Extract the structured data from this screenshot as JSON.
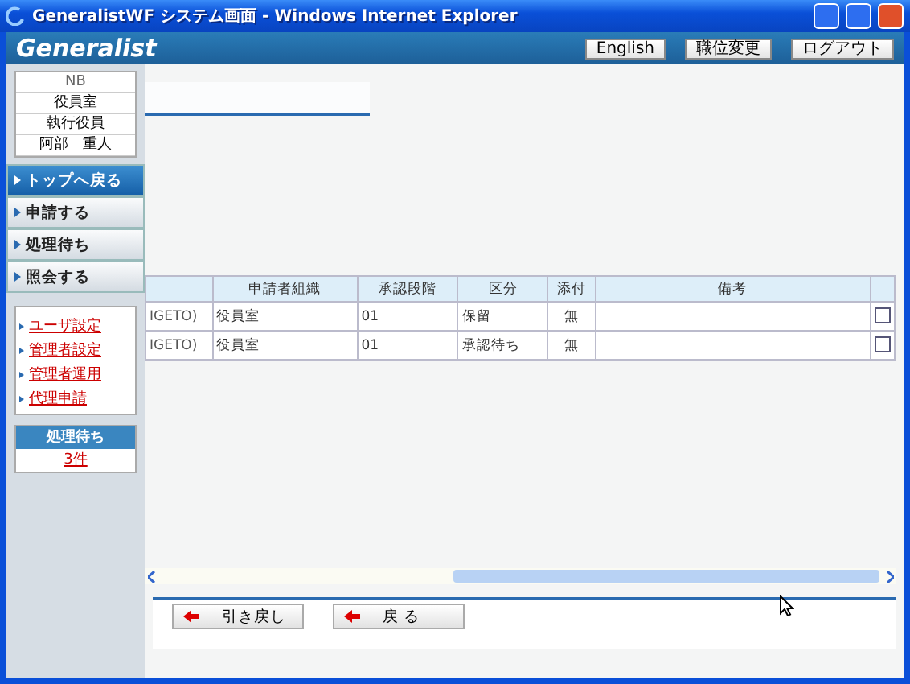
{
  "window": {
    "title": "GeneralistWF システム画面 - Windows Internet Explorer"
  },
  "header": {
    "logo": "Generalist",
    "buttons": [
      "English",
      "職位変更",
      "ログアウト"
    ]
  },
  "user_info": [
    "NB",
    "役員室",
    "執行役員",
    "阿部　重人"
  ],
  "menu": [
    {
      "label": "トップへ戻る",
      "selected": true
    },
    {
      "label": "申請する",
      "selected": false
    },
    {
      "label": "処理待ち",
      "selected": false
    },
    {
      "label": "照会する",
      "selected": false
    }
  ],
  "links": [
    "ユーザ設定",
    "管理者設定",
    "管理者運用",
    "代理申請"
  ],
  "pending": {
    "title": "処理待ち",
    "count": "3件"
  },
  "table": {
    "columns": [
      "申請者組織",
      "承認段階",
      "区分",
      "添付",
      "備考"
    ],
    "rows": [
      {
        "column_1": "IGETO)",
        "cells": [
          "役員室",
          "01",
          "保留",
          "無",
          ""
        ],
        "checked": false
      },
      {
        "column_1": "IGETO)",
        "cells": [
          "役員室",
          "01",
          "承認待ち",
          "無",
          ""
        ],
        "checked": false
      }
    ]
  },
  "actions": [
    "引き戻し",
    "戻 る"
  ]
}
